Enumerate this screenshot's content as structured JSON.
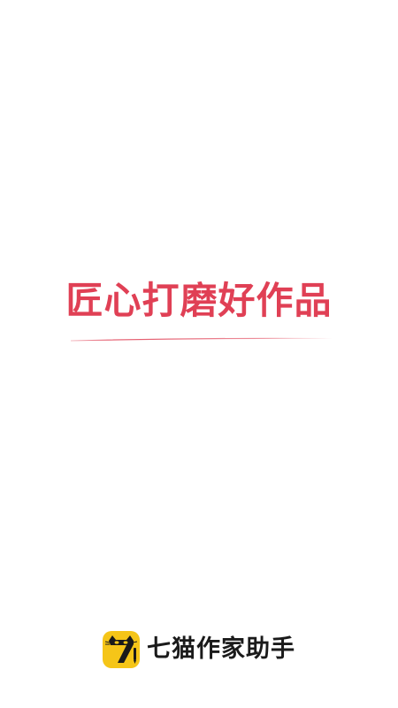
{
  "splash": {
    "slogan": "匠心打磨好作品",
    "brand": {
      "logo_icon": "cat-seven-logo-icon",
      "name": "七猫作家助手"
    }
  },
  "colors": {
    "background": "#ffffff",
    "slogan": "#e04055",
    "logo_background": "#f5c518",
    "logo_figure": "#1a1a1a",
    "brand_text": "#1a1a1a"
  }
}
